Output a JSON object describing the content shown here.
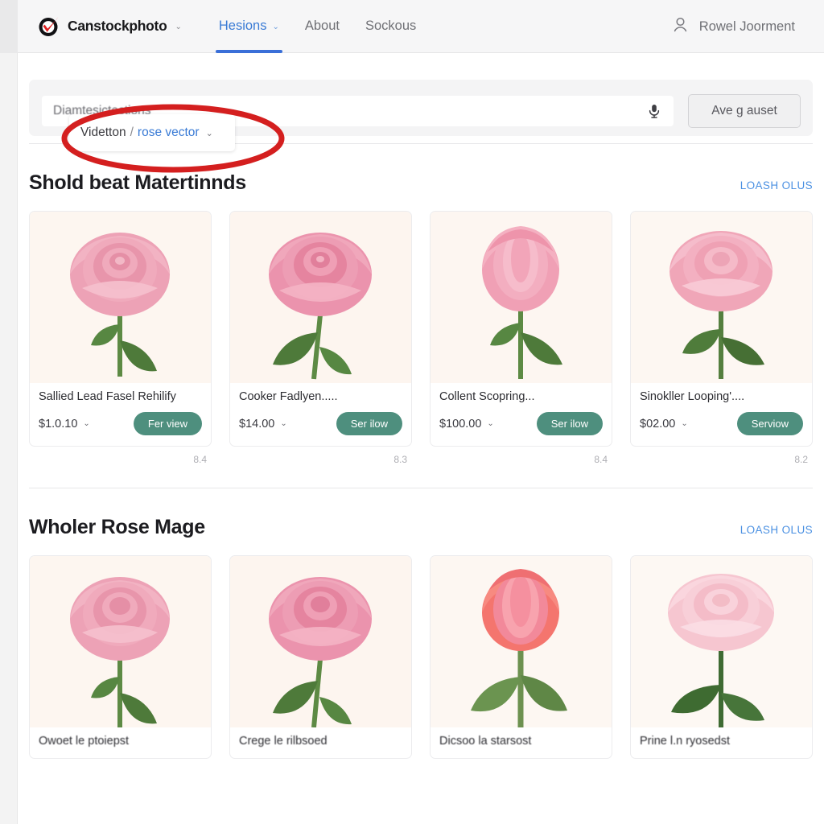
{
  "header": {
    "brand": "Canstockphoto",
    "brand_caret": "⌄",
    "nav": [
      {
        "label": "Hesions",
        "caret": "⌄",
        "active": true
      },
      {
        "label": "About",
        "caret": "",
        "active": false
      },
      {
        "label": "Sockous",
        "caret": "",
        "active": false
      }
    ],
    "account_icon": "user-icon",
    "account_name": "Rowel Joorment"
  },
  "search": {
    "input_value": "Diamtesictections",
    "mic_icon": "microphone-icon",
    "button_label": "Ave g auset",
    "scope": {
      "category": "Videtton",
      "separator": "/",
      "term": "rose vector",
      "caret": "⌄"
    }
  },
  "annotation": {
    "shape": "ellipse",
    "color": "#d41f1f",
    "target": "scope-dropdown"
  },
  "sections": [
    {
      "title": "Shold beat Matertinnds",
      "link": "Loash olus",
      "cards": [
        {
          "title": "Sallied Lead Fasel Rehilify",
          "price": "$1.0.10",
          "caret": "⌄",
          "button": "Fer view",
          "caption": "8.4",
          "rose": "pink"
        },
        {
          "title": "Cooker Fadlyen.....",
          "price": "$14.00",
          "caret": "⌄",
          "button": "Ser ilow",
          "caption": "8.3",
          "rose": "pink-deep"
        },
        {
          "title": "Collent Scopring...",
          "price": "$100.00",
          "caret": "⌄",
          "button": "Ser ilow",
          "caption": "8.4",
          "rose": "pink-bud"
        },
        {
          "title": "Sinokller Looping'....",
          "price": "$02.00",
          "caret": "⌄",
          "button": "Serviow",
          "caption": "8.2",
          "rose": "pink-pale"
        }
      ]
    },
    {
      "title": "Wholer Rose Mage",
      "link": "Loash olus",
      "cards": [
        {
          "title": "Owoet le ptoiepst",
          "rose": "pink"
        },
        {
          "title": "Crege le rilbsoed",
          "rose": "pink-deep"
        },
        {
          "title": "Dicsoo la starsost",
          "rose": "coral"
        },
        {
          "title": "Prine l.n ryosedst",
          "rose": "pink-pale"
        }
      ]
    }
  ],
  "colors": {
    "accent_blue": "#3a7bd5",
    "link_blue": "#4a90e2",
    "pill_green": "#4e8f7e",
    "annotation_red": "#d41f1f",
    "rose_pink": "#efa0b6",
    "rose_coral": "#f4766f",
    "leaf_green": "#5c8a4a"
  }
}
